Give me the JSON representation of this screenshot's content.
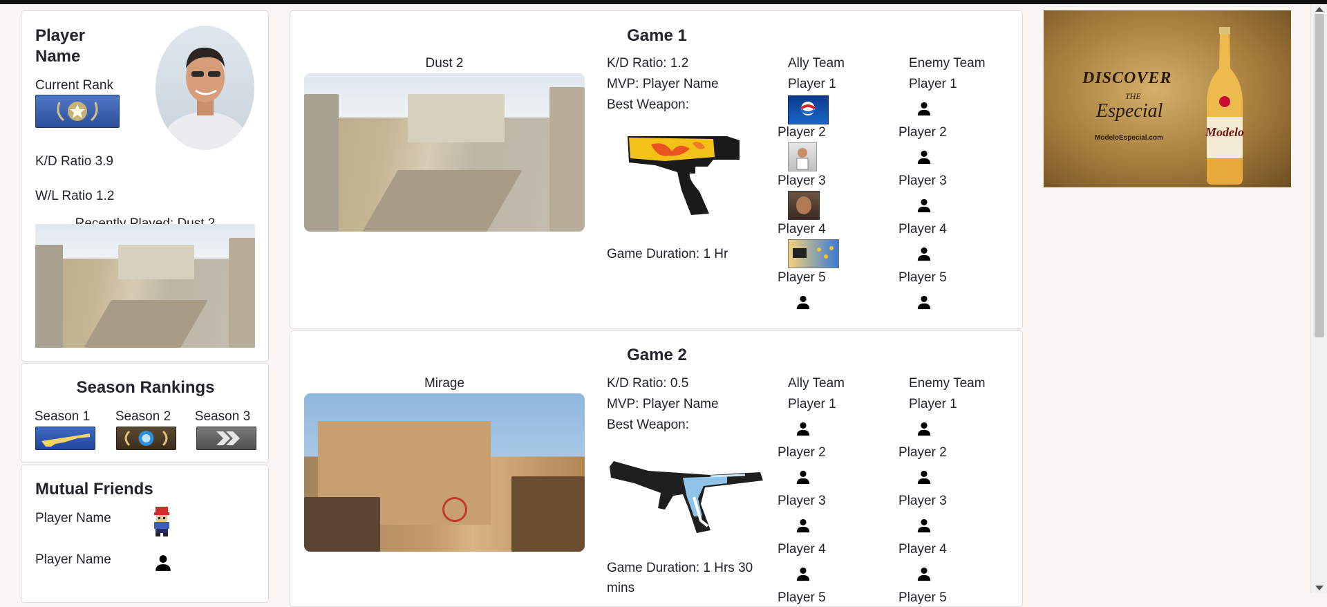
{
  "profile": {
    "player_name": "Player Name",
    "current_rank_label": "Current Rank",
    "kd_ratio": "K/D Ratio 3.9",
    "wl_ratio": "W/L Ratio 1.2",
    "recently_played": "Recently Played: Dust 2"
  },
  "season_rankings": {
    "title": "Season Rankings",
    "seasons": [
      "Season 1",
      "Season 2",
      "Season 3"
    ]
  },
  "mutual_friends": {
    "title": "Mutual Friends",
    "friends": [
      "Player Name",
      "Player Name"
    ]
  },
  "games": [
    {
      "title": "Game 1",
      "map": "Dust 2",
      "kd": "K/D Ratio: 1.2",
      "mvp": "MVP: Player Name",
      "best_weapon": "Best Weapon:",
      "duration": "Game Duration: 1 Hr",
      "ally_header": "Ally Team",
      "enemy_header": "Enemy Team",
      "ally": [
        "Player 1",
        "Player 2",
        "Player 3",
        "Player 4",
        "Player 5"
      ],
      "enemy": [
        "Player 1",
        "Player 2",
        "Player 3",
        "Player 4",
        "Player 5"
      ]
    },
    {
      "title": "Game 2",
      "map": "Mirage",
      "kd": "K/D Ratio: 0.5",
      "mvp": "MVP: Player Name",
      "best_weapon": "Best Weapon:",
      "duration": "Game Duration: 1 Hrs 30 mins",
      "ally_header": "Ally Team",
      "enemy_header": "Enemy Team",
      "ally": [
        "Player 1",
        "Player 2",
        "Player 3",
        "Player 4",
        "Player 5"
      ],
      "enemy": [
        "Player 1",
        "Player 2",
        "Player 3",
        "Player 4",
        "Player 5"
      ]
    }
  ],
  "ad": {
    "headline": "DISCOVER",
    "the": "THE",
    "especial": "Especial",
    "url": "ModeloEspecial.com",
    "brand": "Modelo"
  },
  "icons": [
    "person-icon",
    "avatar",
    "rank-badge-icon",
    "season-rank-icons",
    "weapon-image"
  ]
}
